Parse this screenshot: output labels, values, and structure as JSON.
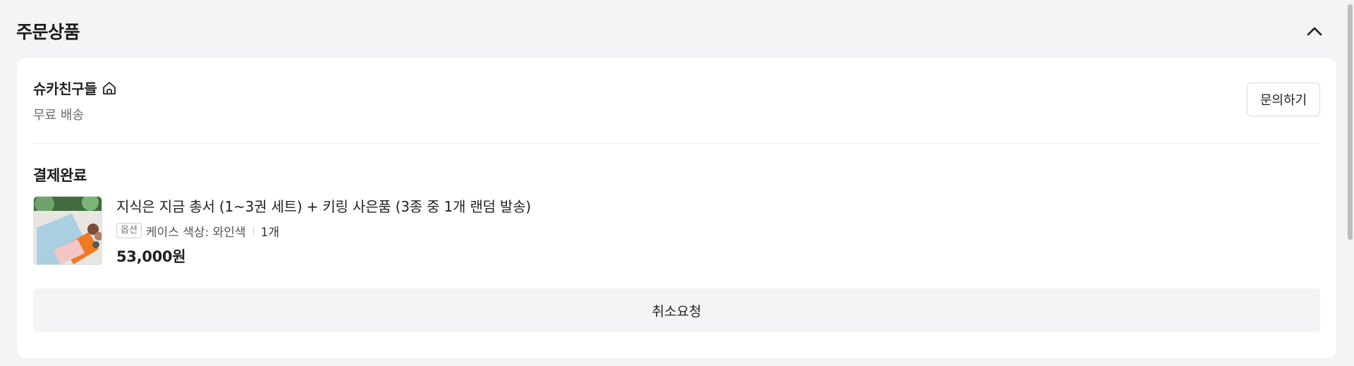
{
  "section": {
    "title": "주문상품",
    "collapse_icon": "chevron-up-icon"
  },
  "seller": {
    "name": "슈카친구들",
    "store_icon": "home-icon",
    "shipping": "무료 배송",
    "inquiry_label": "문의하기"
  },
  "order": {
    "status": "결제완료",
    "product": {
      "name": "지식은 지금 총서 (1~3권 세트) + 키링 사은품 (3종 중 1개 랜덤 발송)",
      "option_badge": "옵션",
      "option_text": "케이스 색상: 와인색",
      "quantity": "1개",
      "price": "53,000원"
    },
    "cancel_label": "취소요청"
  },
  "colors": {
    "page_bg": "#f3f4f6",
    "card_bg": "#ffffff",
    "button_gray": "#f3f4f6"
  }
}
